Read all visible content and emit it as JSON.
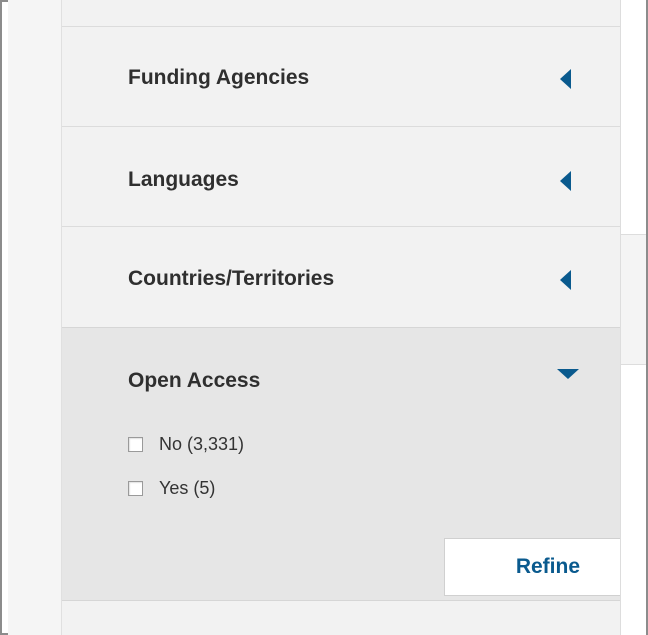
{
  "filters": {
    "sections": [
      {
        "title": "Funding Agencies",
        "expanded": false,
        "arrow_icon": "caret-left-icon"
      },
      {
        "title": "Languages",
        "expanded": false,
        "arrow_icon": "caret-left-icon"
      },
      {
        "title": "Countries/Territories",
        "expanded": false,
        "arrow_icon": "caret-left-icon"
      }
    ],
    "open_access": {
      "title": "Open Access",
      "expanded": true,
      "arrow_icon": "caret-down-icon",
      "options": [
        {
          "label": "No (3,331)",
          "checked": false
        },
        {
          "label": "Yes (5)",
          "checked": false
        }
      ],
      "refine_label": "Refine"
    }
  },
  "colors": {
    "accent": "#0a5a8e",
    "panel_bg": "#f2f2f2",
    "open_section_bg": "#e6e6e6",
    "title_text": "#2f2f2f"
  }
}
